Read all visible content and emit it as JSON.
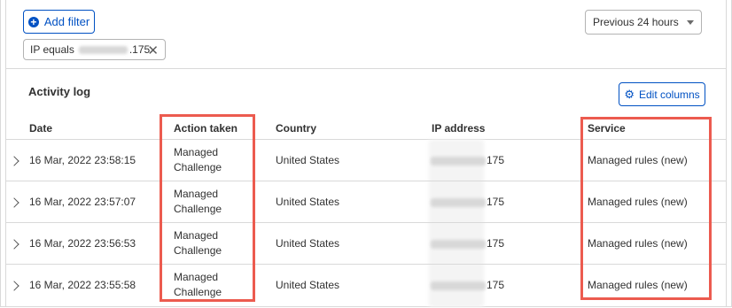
{
  "toolbar": {
    "add_filter_label": "Add filter",
    "filter_chip": {
      "prefix": "IP equals",
      "suffix": ".175"
    },
    "time_range": "Previous 24 hours"
  },
  "activity_log": {
    "title": "Activity log",
    "edit_columns_label": "Edit columns",
    "columns": [
      "Date",
      "Action taken",
      "Country",
      "IP address",
      "Service"
    ],
    "rows": [
      {
        "date": "16 Mar, 2022 23:58:15",
        "action_line1": "Managed",
        "action_line2": "Challenge",
        "country": "United States",
        "ip_suffix": "175",
        "service": "Managed rules (new)"
      },
      {
        "date": "16 Mar, 2022 23:57:07",
        "action_line1": "Managed",
        "action_line2": "Challenge",
        "country": "United States",
        "ip_suffix": "175",
        "service": "Managed rules (new)"
      },
      {
        "date": "16 Mar, 2022 23:56:53",
        "action_line1": "Managed",
        "action_line2": "Challenge",
        "country": "United States",
        "ip_suffix": "175",
        "service": "Managed rules (new)"
      },
      {
        "date": "16 Mar, 2022 23:55:58",
        "action_line1": "Managed",
        "action_line2": "Challenge",
        "country": "United States",
        "ip_suffix": "175",
        "service": "Managed rules (new)"
      }
    ]
  },
  "colors": {
    "accent": "#0051c3",
    "highlight": "#ec5b4f",
    "border": "#d9d9d9"
  },
  "icons": {
    "add": "plus-circle-icon",
    "close": "close-icon",
    "dropdown": "chevron-down-icon",
    "settings": "gear-icon",
    "expand": "chevron-right-icon"
  }
}
